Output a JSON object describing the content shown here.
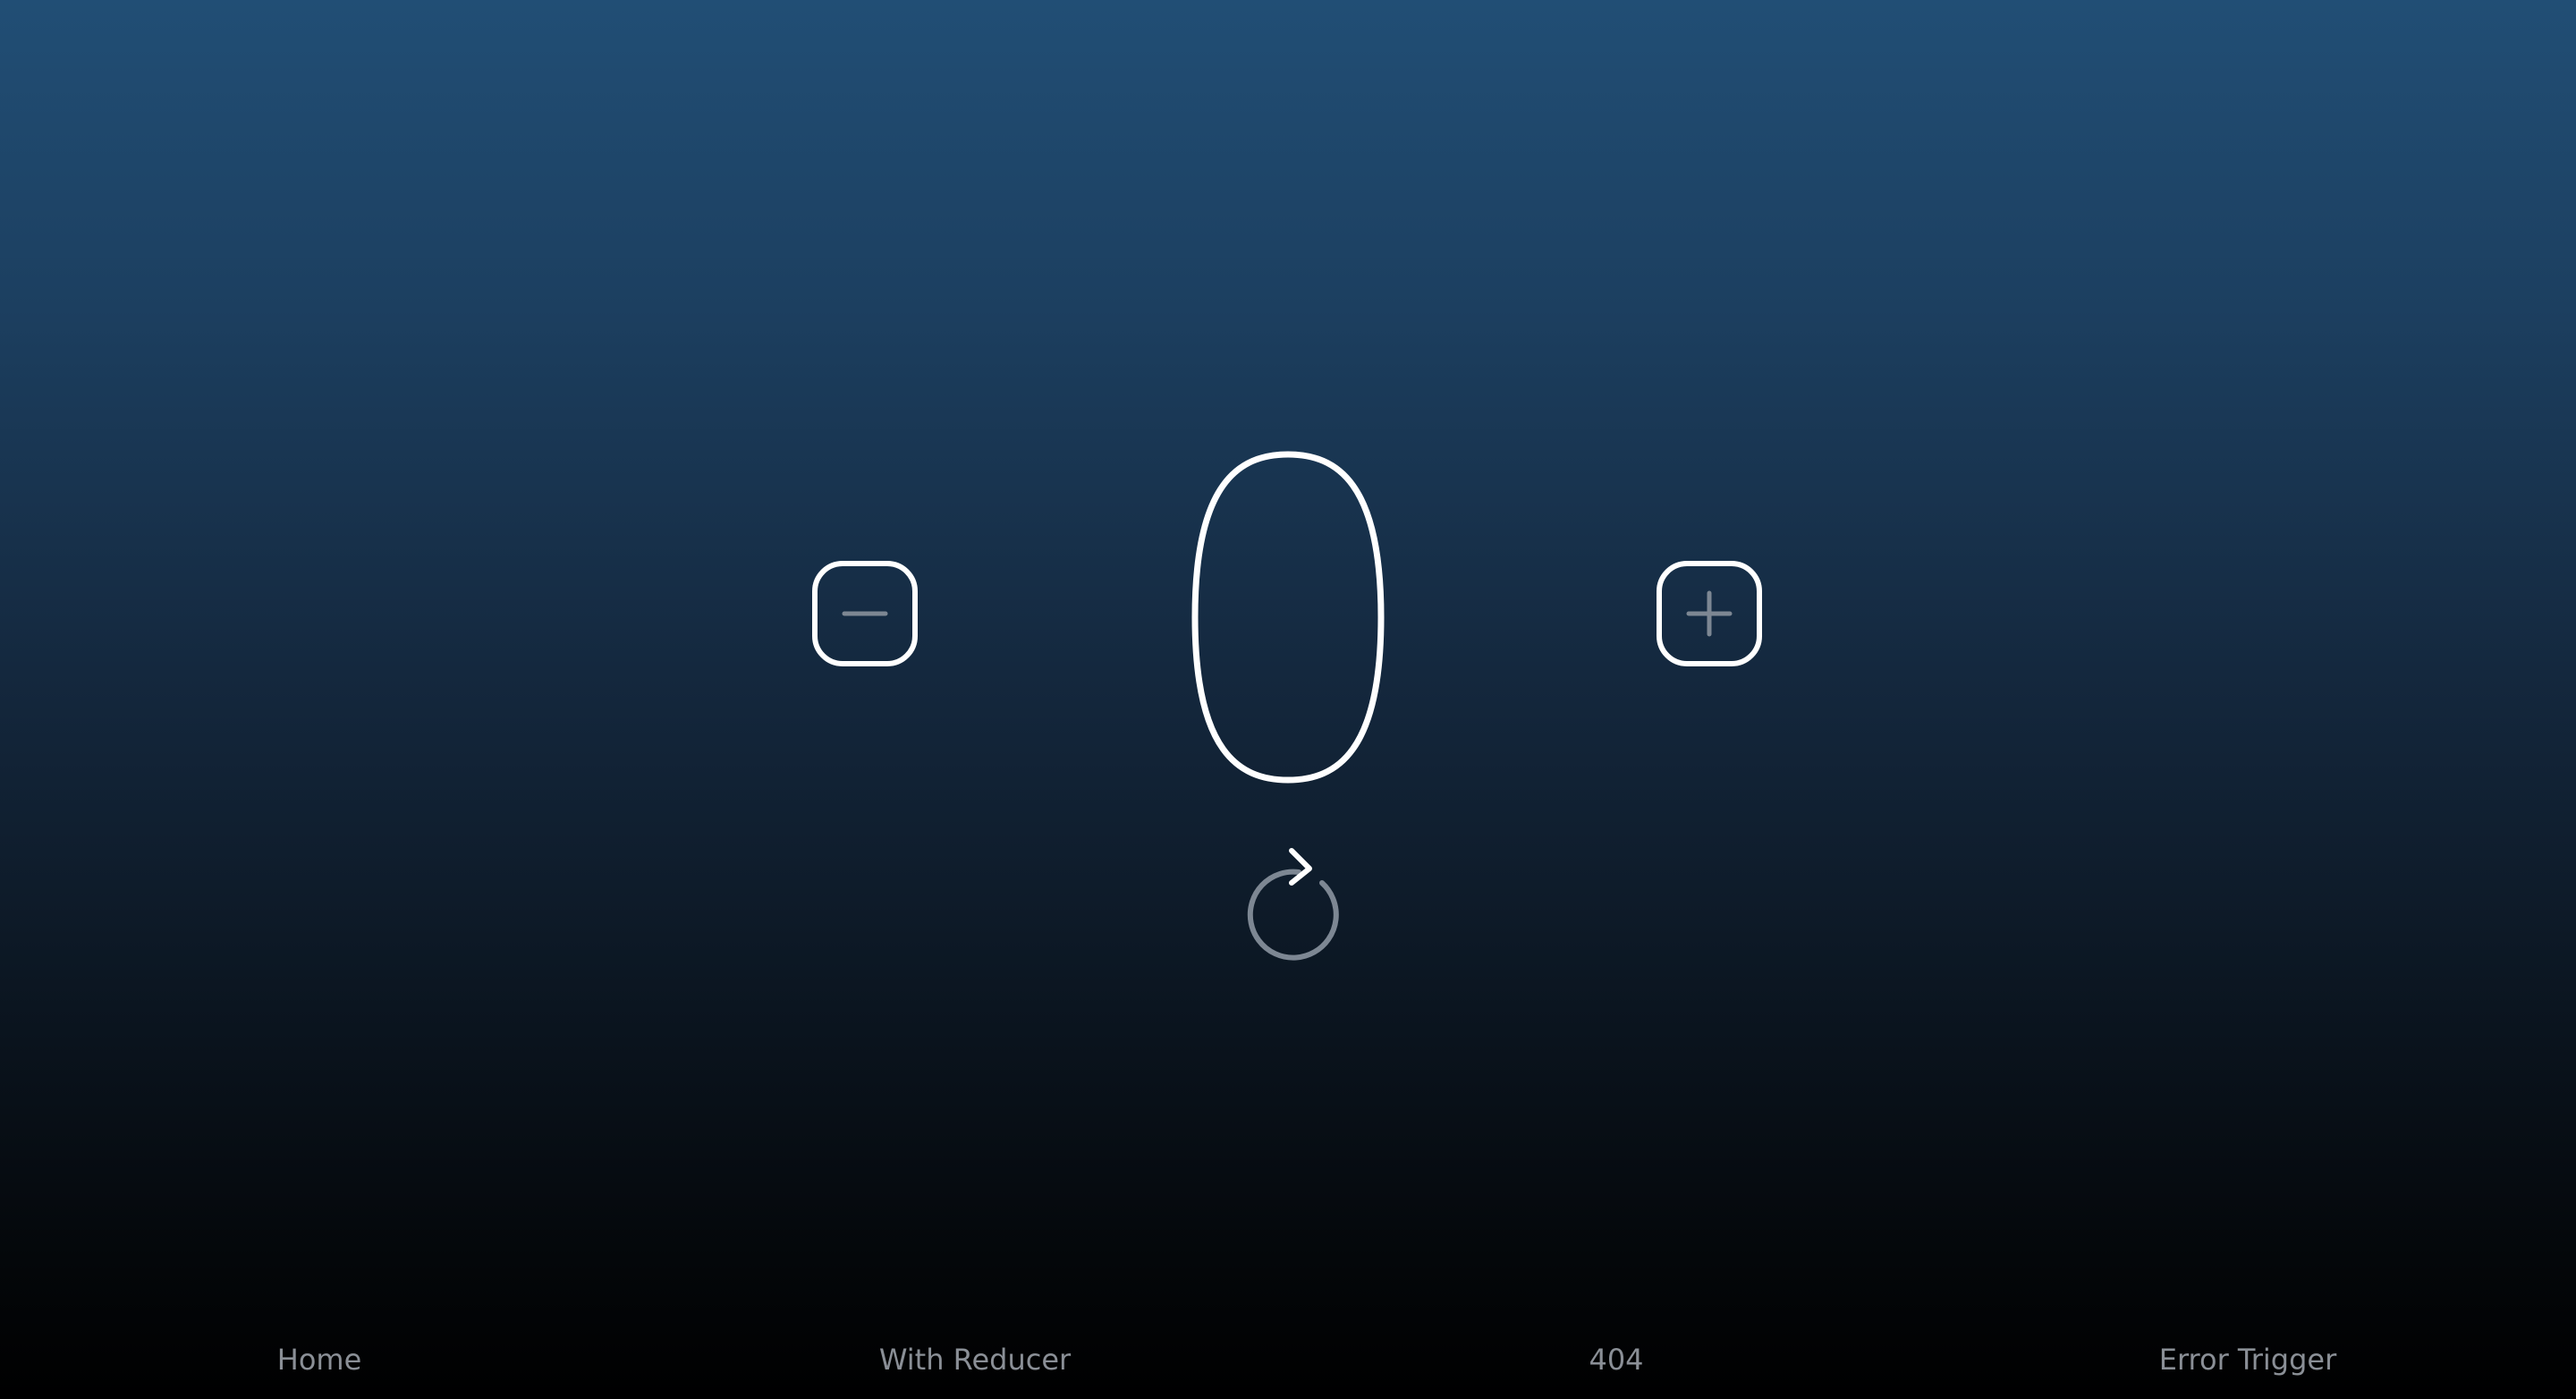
{
  "counter": {
    "value": "0",
    "decrement_icon": "minus-icon",
    "increment_icon": "plus-icon",
    "reset_icon": "refresh-icon"
  },
  "nav": {
    "items": [
      {
        "label": "Home"
      },
      {
        "label": "With Reducer"
      },
      {
        "label": "404"
      },
      {
        "label": "Error Trigger"
      }
    ]
  },
  "colors": {
    "gradient_top": "#214e75",
    "gradient_bottom": "#000000",
    "outline": "#ffffff",
    "icon_glyph": "#7d8793",
    "nav_text": "#8a8f96"
  }
}
